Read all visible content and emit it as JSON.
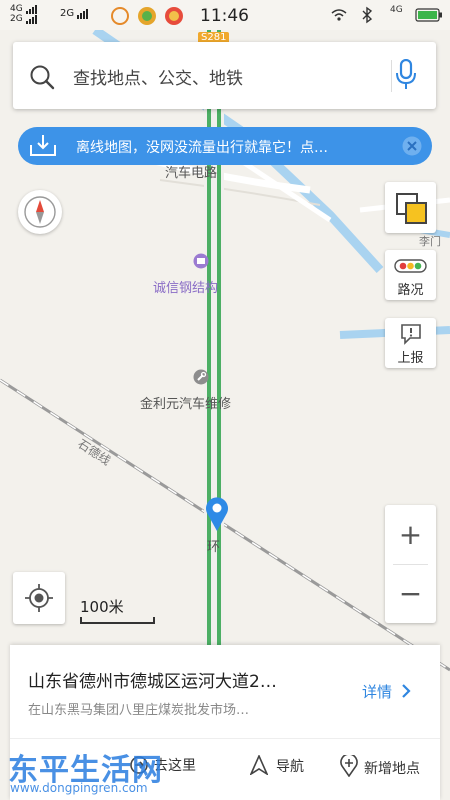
{
  "status_bar": {
    "sim1_label": "4G",
    "sim2_label": "2G",
    "sim_alt_label": "2G",
    "time": "11:46",
    "net_label": "4G",
    "icons": [
      "signal-icon",
      "app-notification-icon",
      "wifi-icon",
      "bluetooth-icon",
      "battery-icon"
    ]
  },
  "map": {
    "road_badge": "S281",
    "labels": {
      "street_1": "汽车电路",
      "poi_1": "诚信钢结构",
      "poi_2": "金利元汽车维修",
      "railway": "石德线",
      "marker_label": "环",
      "edge_label": "李门"
    },
    "route_color": "#4caf64",
    "water_color": "#a9d3f0"
  },
  "search": {
    "placeholder": "查找地点、公交、地铁"
  },
  "banner": {
    "text": "离线地图，没网没流量出行就靠它！点…"
  },
  "controls": {
    "traffic_label": "路况",
    "report_label": "上报",
    "zoom_in": "+",
    "zoom_out": "−"
  },
  "scale": {
    "label": "100米"
  },
  "card": {
    "address": "山东省德州市德城区运河大道2…",
    "sub_address": "在山东黑马集团八里庄煤炭批发市场…",
    "detail_label": "详情",
    "actions": {
      "go_here": "去这里",
      "navigate": "导航",
      "add_place": "新增地点"
    }
  },
  "watermark": {
    "text": "东平生活网",
    "url": "www.dongpingren.com"
  },
  "colors": {
    "accent": "#3d93e8",
    "link": "#2f86e0"
  }
}
